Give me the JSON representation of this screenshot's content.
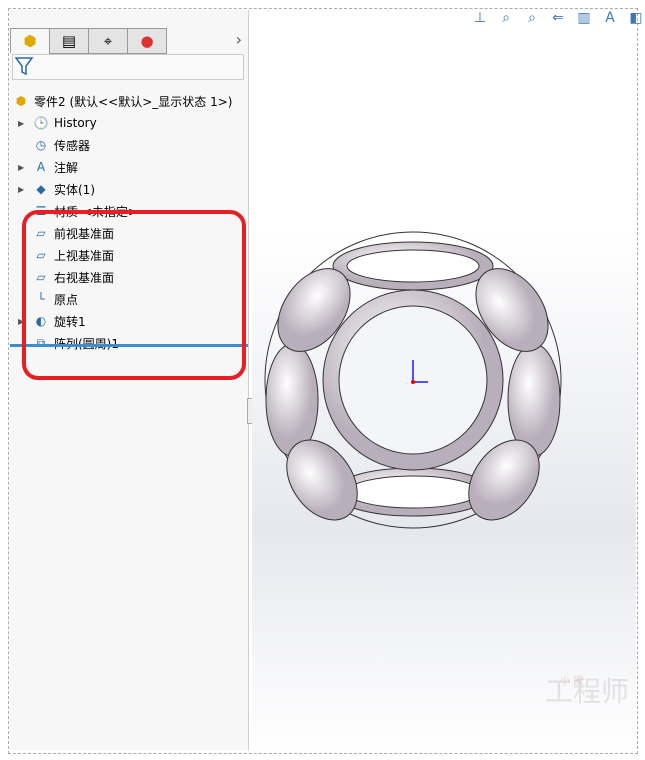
{
  "tabs": [
    {
      "icon": "feature-manager-icon",
      "glyph": "⬢"
    },
    {
      "icon": "property-manager-icon",
      "glyph": "▤"
    },
    {
      "icon": "configuration-manager-icon",
      "glyph": "⌖"
    },
    {
      "icon": "appearance-icon",
      "glyph": "●"
    }
  ],
  "tree": {
    "root": "零件2  (默认<<默认>_显示状态 1>)",
    "items": [
      {
        "label": "History",
        "icon": "history-folder-icon",
        "glyph": "🕒",
        "expand": true
      },
      {
        "label": "传感器",
        "icon": "sensor-folder-icon",
        "glyph": "◷",
        "expand": false
      },
      {
        "label": "注解",
        "icon": "annotation-folder-icon",
        "glyph": "A",
        "expand": true
      },
      {
        "label": "实体(1)",
        "icon": "solid-body-folder-icon",
        "glyph": "◆",
        "expand": true
      },
      {
        "label": "材质 <未指定>",
        "icon": "material-icon",
        "glyph": "☰",
        "expand": false
      },
      {
        "label": "前视基准面",
        "icon": "plane-icon",
        "glyph": "▱",
        "expand": false
      },
      {
        "label": "上视基准面",
        "icon": "plane-icon",
        "glyph": "▱",
        "expand": false
      },
      {
        "label": "右视基准面",
        "icon": "plane-icon",
        "glyph": "▱",
        "expand": false
      },
      {
        "label": "原点",
        "icon": "origin-icon",
        "glyph": "└",
        "expand": false
      },
      {
        "label": "旋转1",
        "icon": "revolve-icon",
        "glyph": "◐",
        "expand": true
      },
      {
        "label": "阵列(圆周)1",
        "icon": "circular-pattern-icon",
        "glyph": "⧉",
        "expand": false
      }
    ]
  },
  "toolbar": [
    {
      "icon": "view-normal-icon",
      "glyph": "⊥"
    },
    {
      "icon": "zoom-to-fit-icon",
      "glyph": "⌕"
    },
    {
      "icon": "zoom-to-area-icon",
      "glyph": "⌕"
    },
    {
      "icon": "previous-view-icon",
      "glyph": "⇐"
    },
    {
      "icon": "section-view-icon",
      "glyph": "▥"
    },
    {
      "icon": "dynamic-annotation-icon",
      "glyph": "A"
    },
    {
      "icon": "view-orientation-icon",
      "glyph": "◧"
    }
  ],
  "watermark": {
    "top": "小  國",
    "main": "工程师"
  },
  "colors": {
    "highlight": "#e81e25",
    "rollback_bar": "#3a8fcf"
  }
}
